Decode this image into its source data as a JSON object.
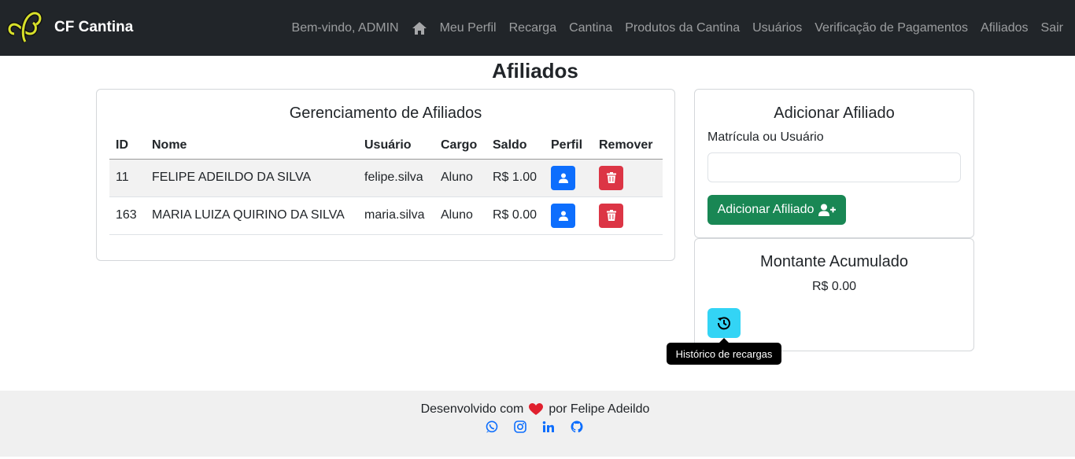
{
  "nav": {
    "brand": "CF Cantina",
    "welcome": "Bem-vindo, ADMIN",
    "links": [
      "Meu Perfil",
      "Recarga",
      "Cantina",
      "Produtos da Cantina",
      "Usuários",
      "Verificação de Pagamentos",
      "Afiliados",
      "Sair"
    ]
  },
  "page": {
    "title": "Afiliados"
  },
  "members": {
    "title": "Gerenciamento de Afiliados",
    "headers": [
      "ID",
      "Nome",
      "Usuário",
      "Cargo",
      "Saldo",
      "Perfil",
      "Remover"
    ],
    "rows": [
      {
        "id": "11",
        "name": "FELIPE ADEILDO DA SILVA",
        "user": "felipe.silva",
        "role": "Aluno",
        "balance": "R$ 1.00"
      },
      {
        "id": "163",
        "name": "MARIA LUIZA QUIRINO DA SILVA",
        "user": "maria.silva",
        "role": "Aluno",
        "balance": "R$ 0.00"
      }
    ]
  },
  "add": {
    "title": "Adicionar Afiliado",
    "label": "Matrícula ou Usuário",
    "value": "",
    "button": "Adicionar Afiliado"
  },
  "total": {
    "title": "Montante Acumulado",
    "value": "R$ 0.00",
    "tooltip": "Histórico de recargas"
  },
  "footer": {
    "before": "Desenvolvido com",
    "after": "por Felipe Adeildo"
  },
  "icons": {
    "home": "home-icon",
    "profile": "user-icon",
    "remove": "trash-icon",
    "add": "user-plus-icon",
    "history": "history-icon",
    "heart": "heart-icon",
    "socials": [
      "whatsapp-icon",
      "instagram-icon",
      "linkedin-icon",
      "github-icon"
    ]
  },
  "colors": {
    "navbar": "#212529",
    "primary": "#0d6efd",
    "danger": "#dc3545",
    "success": "#198754",
    "info": "#33d4f5",
    "footer": "#f0f0f0"
  }
}
